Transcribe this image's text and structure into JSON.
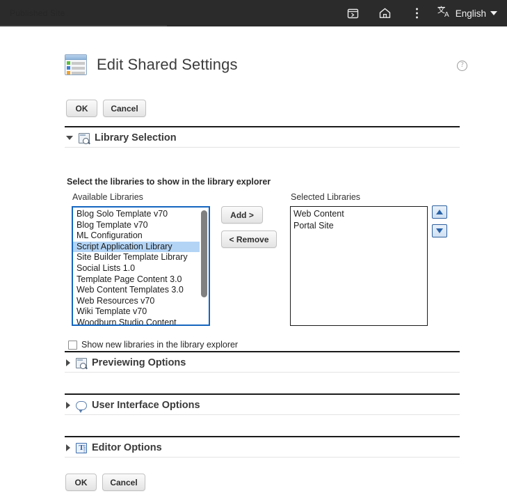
{
  "topbar": {
    "tab_label": "Published Site",
    "icons": [
      {
        "name": "panel-icon"
      },
      {
        "name": "home-icon"
      },
      {
        "name": "more-vertical-icon"
      }
    ],
    "language": {
      "icon": "translate-icon",
      "label": "English",
      "caret": "chevron-down-icon"
    }
  },
  "nav": {
    "menu_button": "menu-icon"
  },
  "page": {
    "title": "Edit Shared Settings",
    "icon": "shared-settings-icon",
    "help_icon": "help-icon",
    "help_glyph": "?"
  },
  "actions_top": {
    "ok_label": "OK",
    "cancel_label": "Cancel"
  },
  "actions_bottom": {
    "ok_label": "OK",
    "cancel_label": "Cancel"
  },
  "sections": [
    {
      "id": "library-selection",
      "title": "Library Selection",
      "icon": "preview-magnifier-icon",
      "expanded": true
    },
    {
      "id": "previewing-options",
      "title": "Previewing Options",
      "icon": "preview-magnifier-icon",
      "expanded": false
    },
    {
      "id": "user-interface-options",
      "title": "User Interface Options",
      "icon": "speech-bubble-icon",
      "expanded": false
    },
    {
      "id": "editor-options",
      "title": "Editor Options",
      "icon": "text-editor-icon",
      "expanded": false
    }
  ],
  "library_selection": {
    "instruction": "Select the libraries to show in the library explorer",
    "available_label": "Available Libraries",
    "selected_label": "Selected Libraries",
    "available_items": [
      "Blog Solo Template v70",
      "Blog Template v70",
      "ML Configuration",
      "Script Application Library",
      "Site Builder Template Library",
      "Social Lists 1.0",
      "Template Page Content 3.0",
      "Web Content Templates 3.0",
      "Web Resources v70",
      "Wiki Template v70",
      "Woodburn Studio Content"
    ],
    "available_selected_index": 3,
    "selected_items": [
      "Web Content",
      "Portal Site"
    ],
    "add_label": "Add >",
    "remove_label": "< Remove",
    "move_up_icon": "arrow-up-icon",
    "move_down_icon": "arrow-down-icon",
    "checkbox_label": "Show new libraries in the library explorer",
    "checkbox_checked": false
  },
  "colors": {
    "topbar_bg": "#2b2b2b",
    "focus_border": "#1565c0",
    "selection_highlight": "#b3d4f5",
    "arrow_blue": "#2a63a8"
  }
}
